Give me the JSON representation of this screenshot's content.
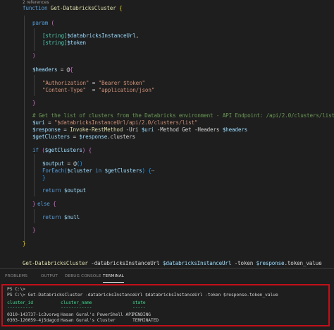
{
  "editor": {
    "codelens": "2 references",
    "code": {
      "l1_kw": "function",
      "l1_name": "Get-DatabricksCluster",
      "l3_kw": "param",
      "l5_type1": "[string]",
      "l5_var1": "$databricksInstanceUrl",
      "l6_type2": "[string]",
      "l6_var2": "$token",
      "l9_var": "$headers",
      "l11_key1": "\"Authorization\"",
      "l11_val1": "\"Bearer $token\"",
      "l12_key2": "\"Content-Type\"",
      "l12_val2": "\"application/json\"",
      "l15_comment": "# Get the list of clusters from the Databricks environment - API Endpoint: /api/2.0/clusters/list",
      "l16_var": "$uri",
      "l16_str": "\"$databricksInstanceUrl/api/2.0/clusters/list\"",
      "l17_var": "$response",
      "l17_cmd": "Invoke-RestMethod",
      "l17_p1": "-Uri",
      "l17_v1": "$uri",
      "l17_p2": "-Method",
      "l17_m": "Get",
      "l17_p3": "-Headers",
      "l17_v3": "$headers",
      "l18_var": "$getClusters",
      "l18_val": "$response",
      "l18_prop": ".clusters",
      "l20_kw": "if",
      "l20_var": "$getClusters",
      "l22_var": "$output",
      "l23_fe": "ForEach",
      "l23_v1": "$cluster",
      "l23_in": "in",
      "l23_v2": "$getClusters",
      "l23_ell": "⋯",
      "l26_kw": "return",
      "l26_var": "$output",
      "l28_kw": "else",
      "l30_kw": "return",
      "l30_var": "$null",
      "l37_cmd": "Get-DatabricksCluster",
      "l37_p1": "-databricksInstanceUrl",
      "l37_v1": "$databricksInstanceUrl",
      "l37_p2": "-token",
      "l37_v2": "$response",
      "l37_prop": ".token_value"
    }
  },
  "panel": {
    "tabs": [
      "PROBLEMS",
      "OUTPUT",
      "DEBUG CONSOLE",
      "TERMINAL"
    ],
    "active_tab": "TERMINAL",
    "terminal": {
      "line1": "PS C:\\>",
      "line2": "PS C:\\> Get-DatabricksCluster -databricksInstanceUrl $databricksInstanceUrl -token $response.token_value",
      "col_id": "cluster_id",
      "col_name": "cluster_name",
      "col_state": "state",
      "sep_id": "----------",
      "sep_name": "------------",
      "sep_state": "-----",
      "rows": [
        {
          "id": "0310-143737-1c3vorwg",
          "name": "Hasan Gural's PowerShell API",
          "state": "PENDING"
        },
        {
          "id": "0303-120059-4j5dagcd",
          "name": "Hasan Gural's Cluster",
          "state": "TERMINATED"
        }
      ]
    }
  },
  "colors": {
    "background": "#1e1e1e",
    "keyword": "#569cd6",
    "function": "#dcdcaa",
    "variable": "#9cdcfe",
    "string": "#ce9178",
    "type": "#4ec9b0",
    "comment": "#6a9955",
    "terminal_highlight_border": "#c0101a",
    "terminal_header": "#3dd68c"
  }
}
